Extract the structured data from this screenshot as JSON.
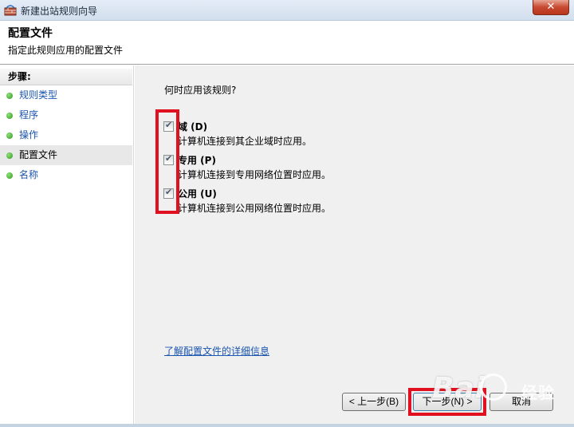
{
  "window": {
    "title": "新建出站规则向导",
    "close_label": "✕"
  },
  "header": {
    "title": "配置文件",
    "subtitle": "指定此规则应用的配置文件"
  },
  "sidebar": {
    "steps_label": "步骤:",
    "items": [
      {
        "label": "规则类型",
        "state": "link"
      },
      {
        "label": "程序",
        "state": "link"
      },
      {
        "label": "操作",
        "state": "link"
      },
      {
        "label": "配置文件",
        "state": "current"
      },
      {
        "label": "名称",
        "state": "link"
      }
    ]
  },
  "main": {
    "question": "何时应用该规则?",
    "options": [
      {
        "title": "域 (D)",
        "description": "计算机连接到其企业域时应用。",
        "checked": true
      },
      {
        "title": "专用 (P)",
        "description": "计算机连接到专用网络位置时应用。",
        "checked": true
      },
      {
        "title": "公用 (U)",
        "description": "计算机连接到公用网络位置时应用。",
        "checked": true
      }
    ],
    "more_info_link": "了解配置文件的详细信息"
  },
  "buttons": {
    "back": "< 上一步(B)",
    "next": "下一步(N) >",
    "cancel": "取消"
  },
  "watermark": {
    "text": "Bai",
    "cn": "经验"
  },
  "colors": {
    "highlight_box": "#e01020",
    "link": "#1a55b0",
    "step_dot": "#2f9a1c"
  }
}
